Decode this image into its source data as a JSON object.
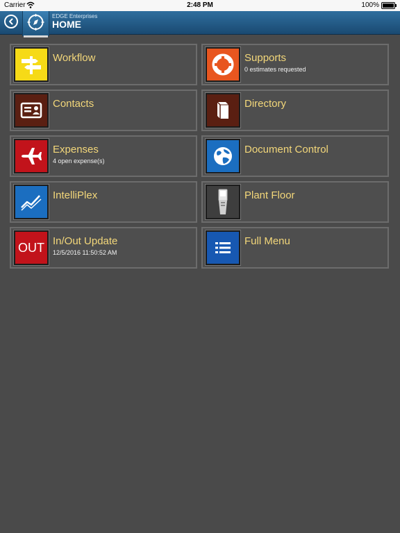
{
  "status_bar": {
    "carrier": "Carrier",
    "time": "2:48 PM",
    "battery": "100%"
  },
  "nav": {
    "subtitle": "EDGE Enterprises",
    "title": "HOME"
  },
  "tiles": [
    {
      "title": "Workflow",
      "subtitle": "",
      "icon": "signpost-icon",
      "color": "#f6da17"
    },
    {
      "title": "Supports",
      "subtitle": "0 estimates requested",
      "icon": "lifebuoy-icon",
      "color": "#e8561f"
    },
    {
      "title": "Contacts",
      "subtitle": "",
      "icon": "contact-card-icon",
      "color": "#5a1f12"
    },
    {
      "title": "Directory",
      "subtitle": "",
      "icon": "book-icon",
      "color": "#5a1f12"
    },
    {
      "title": "Expenses",
      "subtitle": "4 open expense(s)",
      "icon": "airplane-icon",
      "color": "#c2131b"
    },
    {
      "title": "Document Control",
      "subtitle": "",
      "icon": "globe-icon",
      "color": "#1b6ec0"
    },
    {
      "title": "IntelliPlex",
      "subtitle": "",
      "icon": "line-chart-icon",
      "color": "#1b6ec0"
    },
    {
      "title": "Plant Floor",
      "subtitle": "",
      "icon": "handheld-scanner-icon",
      "color": "#3e3e3e"
    },
    {
      "title": "In/Out Update",
      "subtitle": "12/5/2016 11:50:52 AM",
      "icon": "out-icon",
      "icon_text": "OUT",
      "color": "#c2131b"
    },
    {
      "title": "Full Menu",
      "subtitle": "",
      "icon": "list-menu-icon",
      "color": "#1758b2"
    }
  ]
}
